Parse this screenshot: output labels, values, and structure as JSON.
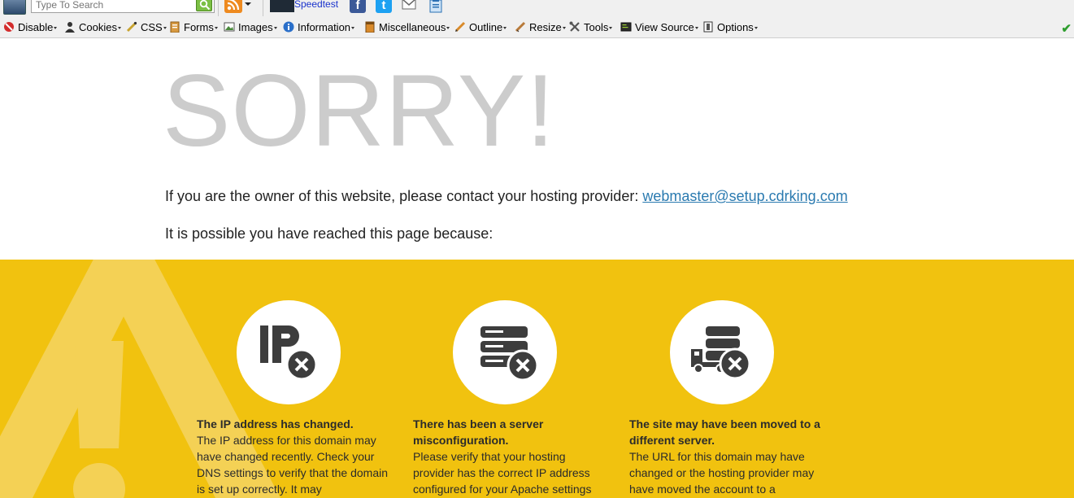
{
  "toolbar_top": {
    "search_placeholder": "Type To Search",
    "speedtest_label": "Speedtest",
    "icons": [
      "app-icon",
      "search-go-icon",
      "rss-icon",
      "speedtest-icon",
      "facebook-icon",
      "twitter-icon",
      "gmail-icon",
      "clipboard-icon"
    ],
    "colors": {
      "facebook": "#3b5998",
      "twitter": "#1da1f2",
      "rss": "#ee8a1f",
      "search_go": "#7bbf44"
    }
  },
  "web_developer_toolbar": {
    "items": [
      {
        "label": "Disable",
        "icon": "disable-icon"
      },
      {
        "label": "Cookies",
        "icon": "cookies-icon"
      },
      {
        "label": "CSS",
        "icon": "css-icon"
      },
      {
        "label": "Forms",
        "icon": "forms-icon"
      },
      {
        "label": "Images",
        "icon": "images-icon"
      },
      {
        "label": "Information",
        "icon": "information-icon"
      },
      {
        "label": "Miscellaneous",
        "icon": "miscellaneous-icon"
      },
      {
        "label": "Outline",
        "icon": "outline-icon"
      },
      {
        "label": "Resize",
        "icon": "resize-icon"
      },
      {
        "label": "Tools",
        "icon": "tools-icon"
      },
      {
        "label": "View Source",
        "icon": "view-source-icon"
      },
      {
        "label": "Options",
        "icon": "options-icon"
      }
    ],
    "status_icon": "checkmark-icon"
  },
  "page": {
    "heading": "SORRY!",
    "owner_text": "If you are the owner of this website, please contact your hosting provider: ",
    "contact_email": "webmaster@setup.cdrking.com",
    "possible_text": "It is possible you have reached this page because:",
    "band_color": "#f1c20f",
    "reasons": [
      {
        "icon": "ip-error-icon",
        "title": "The IP address has changed.",
        "body": "The IP address for this domain may have changed recently. Check your DNS settings to verify that the domain is set up correctly. It may"
      },
      {
        "icon": "server-error-icon",
        "title": "There has been a server misconfiguration.",
        "body": "Please verify that your hosting provider has the correct IP address configured for your Apache settings"
      },
      {
        "icon": "server-moved-icon",
        "title": "The site may have been moved to a different server.",
        "body": "The URL for this domain may have changed or the hosting provider may have moved the account to a"
      }
    ]
  }
}
